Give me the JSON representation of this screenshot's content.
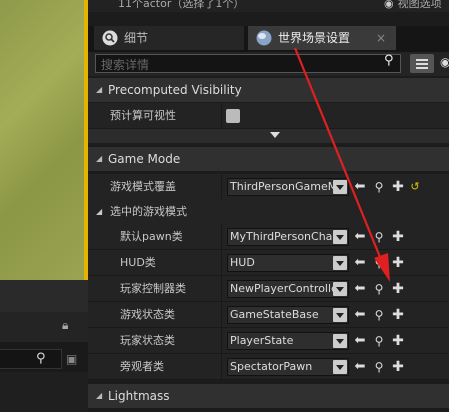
{
  "header": {
    "actor_count": "11个actor（选择了1个）",
    "view_options": "视图选项"
  },
  "tabs": [
    {
      "label": "细节"
    },
    {
      "label": "世界场景设置",
      "close": "×"
    }
  ],
  "search": {
    "placeholder": "搜索详情"
  },
  "sections": {
    "precomputed": "Precomputed Visibility",
    "game_mode": "Game Mode",
    "lightmass": "Lightmass"
  },
  "precomputed_visibility": {
    "label": "预计算可视性",
    "checked": false
  },
  "game_mode": {
    "override": {
      "label": "游戏模式覆盖",
      "value": "ThirdPersonGameMode"
    },
    "selected_group": "选中的游戏模式",
    "rows": [
      {
        "label": "默认pawn类",
        "value": "MyThirdPersonCharacter"
      },
      {
        "label": "HUD类",
        "value": "HUD"
      },
      {
        "label": "玩家控制器类",
        "value": "NewPlayerController"
      },
      {
        "label": "游戏状态类",
        "value": "GameStateBase"
      },
      {
        "label": "玩家状态类",
        "value": "PlayerState"
      },
      {
        "label": "旁观者类",
        "value": "SpectatorPawn"
      }
    ]
  },
  "colors": {
    "annotation_arrow": "#e02020",
    "viewport_selection": "#e5b300",
    "reset_icon": "#e3c200"
  },
  "icons": [
    "magnifier-icon",
    "globe-icon",
    "close-icon",
    "search-icon",
    "grid-icon",
    "eye-icon",
    "lock-icon",
    "save-icon",
    "back-arrow-icon",
    "find-icon",
    "add-icon",
    "reset-icon"
  ]
}
